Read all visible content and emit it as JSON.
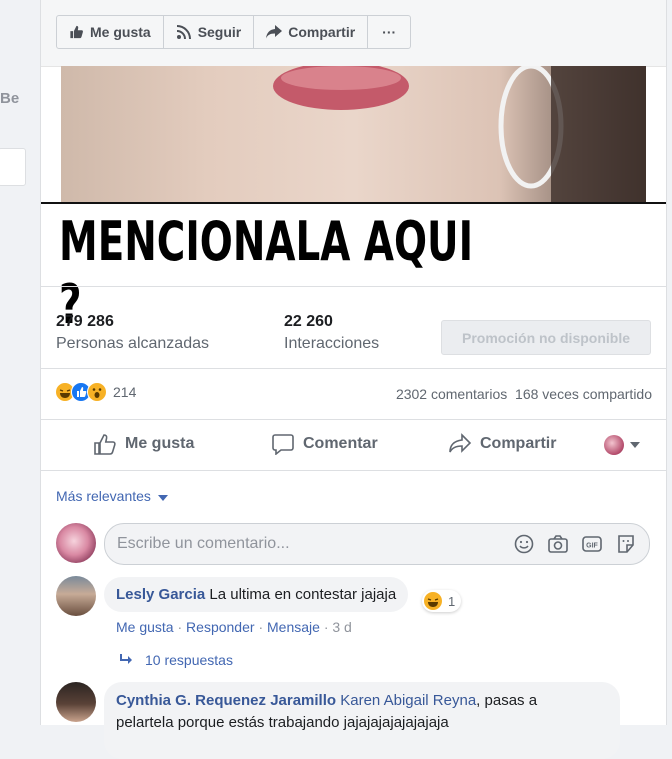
{
  "sidebar": {
    "partial_text": "Be"
  },
  "toolbar": {
    "like": "Me gusta",
    "follow": "Seguir",
    "share": "Compartir",
    "more": "···"
  },
  "post": {
    "image_text": "MENCIONALA AQUI ?"
  },
  "insights": {
    "reach_value": "279 286",
    "reach_label": "Personas alcanzadas",
    "engagement_value": "22 260",
    "engagement_label": "Interacciones",
    "promo_button": "Promoción no disponible"
  },
  "reactions": {
    "count": "214",
    "comments": "2302 comentarios",
    "shares": "168 veces compartido",
    "types": [
      "haha-icon",
      "like-icon",
      "wow-icon"
    ]
  },
  "actions": {
    "like": "Me gusta",
    "comment": "Comentar",
    "share": "Compartir"
  },
  "comments_section": {
    "sort_label": "Más relevantes",
    "input_placeholder": "Escribe un comentario..."
  },
  "comments": [
    {
      "author": "Lesly Garcia",
      "text": "La ultima en contestar jajaja",
      "reaction_count": "1",
      "like": "Me gusta",
      "reply": "Responder",
      "message": "Mensaje",
      "time": "3 d",
      "replies": "10 respuestas"
    },
    {
      "author": "Cynthia G. Requenez Jaramillo",
      "mention": "Karen Abigail Reyna",
      "text_line1": ", pasas a",
      "text_line2": "pelartela porque estás trabajando jajajajajajajajaja"
    }
  ],
  "colors": {
    "link": "#385898",
    "accent": "#4267b2",
    "muted": "#606770"
  }
}
